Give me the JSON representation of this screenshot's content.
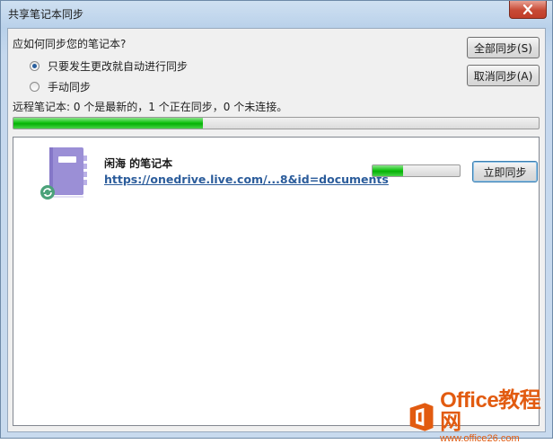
{
  "window": {
    "title": "共享笔记本同步"
  },
  "sync": {
    "question": "应如何同步您的笔记本?",
    "options": [
      {
        "label": "只要发生更改就自动进行同步",
        "checked": true
      },
      {
        "label": "手动同步",
        "checked": false
      }
    ],
    "sync_all_label": "全部同步(S)",
    "cancel_sync_label": "取消同步(A)",
    "status_text": "远程笔记本: 0 个是最新的，1 个正在同步，0 个未连接。",
    "overall_progress": 0.36
  },
  "notebooks": [
    {
      "name": "闲海 的笔记本",
      "url": "https://onedrive.live.com/...8&id=documents",
      "progress": 0.35,
      "sync_now_label": "立即同步"
    }
  ],
  "watermark": {
    "brand": "Office教程网",
    "url": "www.office26.com"
  },
  "colors": {
    "progress": "#06b106",
    "link": "#2b5c9b",
    "watermark": "#e25b10",
    "notebook": "#9b8fd6"
  }
}
